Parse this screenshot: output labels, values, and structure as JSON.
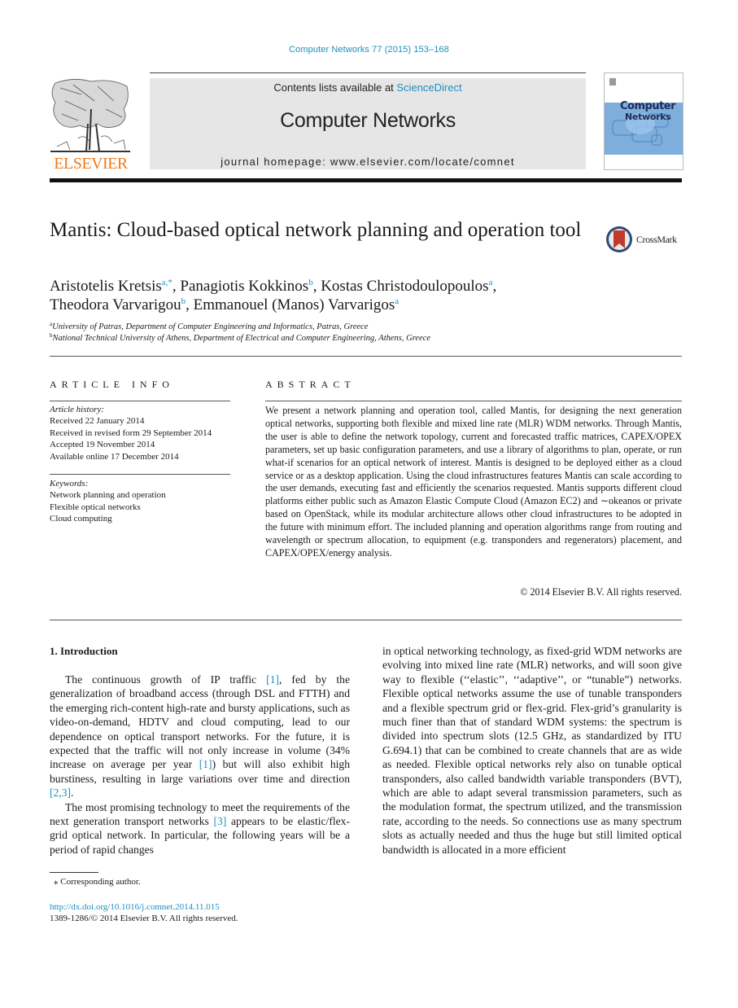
{
  "header": {
    "journal_reference": "Computer Networks 77 (2015) 153–168",
    "contents_prefix": "Contents lists available at ",
    "contents_link": "ScienceDirect",
    "journal_name": "Computer Networks",
    "homepage_line": "journal homepage: www.elsevier.com/locate/comnet",
    "publisher_logo_text": "ELSEVIER",
    "cover_title_line1": "Computer",
    "cover_title_line2": "Networks",
    "brand_color": "#f07a1c",
    "link_color": "#1d8fbf"
  },
  "crossmark": {
    "label": "CrossMark"
  },
  "title": "Mantis: Cloud-based optical network planning and operation tool",
  "authors": [
    {
      "name": "Aristotelis Kretsis",
      "sup": "a,*",
      "sep": ", "
    },
    {
      "name": "Panagiotis Kokkinos",
      "sup": "b",
      "sep": ", "
    },
    {
      "name": "Kostas Christodoulopoulos",
      "sup": "a",
      "sep": ","
    },
    {
      "name": "Theodora Varvarigou",
      "sup": "b",
      "sep": ", "
    },
    {
      "name": "Emmanouel (Manos) Varvarigos",
      "sup": "a",
      "sep": ""
    }
  ],
  "affiliations": [
    {
      "mark": "a",
      "text": "University of Patras, Department of Computer Engineering and Informatics, Patras, Greece"
    },
    {
      "mark": "b",
      "text": "National Technical University of Athens, Department of Electrical and Computer Engineering, Athens, Greece"
    }
  ],
  "article_info": {
    "heading": "ARTICLE INFO",
    "history_label": "Article history:",
    "history": [
      "Received 22 January 2014",
      "Received in revised form 29 September 2014",
      "Accepted 19 November 2014",
      "Available online 17 December 2014"
    ],
    "keywords_label": "Keywords:",
    "keywords": [
      "Network planning and operation",
      "Flexible optical networks",
      "Cloud computing"
    ]
  },
  "abstract": {
    "heading": "ABSTRACT",
    "text": "We present a network planning and operation tool, called Mantis, for designing the next generation optical networks, supporting both flexible and mixed line rate (MLR) WDM networks. Through Mantis, the user is able to define the network topology, current and forecasted traffic matrices, CAPEX/OPEX parameters, set up basic configuration parameters, and use a library of algorithms to plan, operate, or run what-if scenarios for an optical network of interest. Mantis is designed to be deployed either as a cloud service or as a desktop application. Using the cloud infrastructures features Mantis can scale according to the user demands, executing fast and efficiently the scenarios requested. Mantis supports different cloud platforms either public such as Amazon Elastic Compute Cloud (Amazon EC2) and ∼okeanos or private based on OpenStack, while its modular architecture allows other cloud infrastructures to be adopted in the future with minimum effort. The included planning and operation algorithms range from routing and wavelength or spectrum allocation, to equipment (e.g. transponders and regenerators) placement, and CAPEX/OPEX/energy analysis.",
    "copyright": "© 2014 Elsevier B.V. All rights reserved."
  },
  "body": {
    "section_heading": "1. Introduction",
    "left_paragraphs": [
      [
        {
          "t": "The continuous growth of IP traffic "
        },
        {
          "ref": "[1]"
        },
        {
          "t": ", fed by the generalization of broadband access (through DSL and FTTH) and the emerging rich-content high-rate and bursty applications, such as video-on-demand, HDTV and cloud computing, lead to our dependence on optical transport networks. For the future, it is expected that the traffic will not only increase in volume (34% increase on average per year "
        },
        {
          "ref": "[1]"
        },
        {
          "t": ") but will also exhibit high burstiness, resulting in large variations over time and direction "
        },
        {
          "ref": "[2,3]"
        },
        {
          "t": "."
        }
      ],
      [
        {
          "t": "The most promising technology to meet the requirements of the next generation transport networks "
        },
        {
          "ref": "[3]"
        },
        {
          "t": " appears to be elastic/flex-grid optical network. In particular, the following years will be a period of rapid changes"
        }
      ]
    ],
    "right_paragraphs": [
      [
        {
          "t": "in optical networking technology, as fixed-grid WDM networks are evolving into mixed line rate (MLR) networks, and will soon give way to flexible (‘‘elastic’’, ‘‘adaptive’’, or “tunable”) networks. Flexible optical networks assume the use of tunable transponders and a flexible spectrum grid or flex-grid. Flex-grid’s granularity is much finer than that of standard WDM systems: the spectrum is divided into spectrum slots (12.5 GHz, as standardized by ITU G.694.1) that can be combined to create channels that are as wide as needed. Flexible optical networks rely also on tunable optical transponders, also called bandwidth variable transponders (BVT), which are able to adapt several transmission parameters, such as the modulation format, the spectrum utilized, and the transmission rate, according to the needs. So connections use as many spectrum slots as actually needed and thus the huge but still limited optical bandwidth is allocated in a more efficient"
        }
      ]
    ]
  },
  "footnote": {
    "mark": "⁎",
    "text": "Corresponding author."
  },
  "footer": {
    "doi": "http://dx.doi.org/10.1016/j.comnet.2014.11.015",
    "issn_copyright": "1389-1286/© 2014 Elsevier B.V. All rights reserved."
  }
}
